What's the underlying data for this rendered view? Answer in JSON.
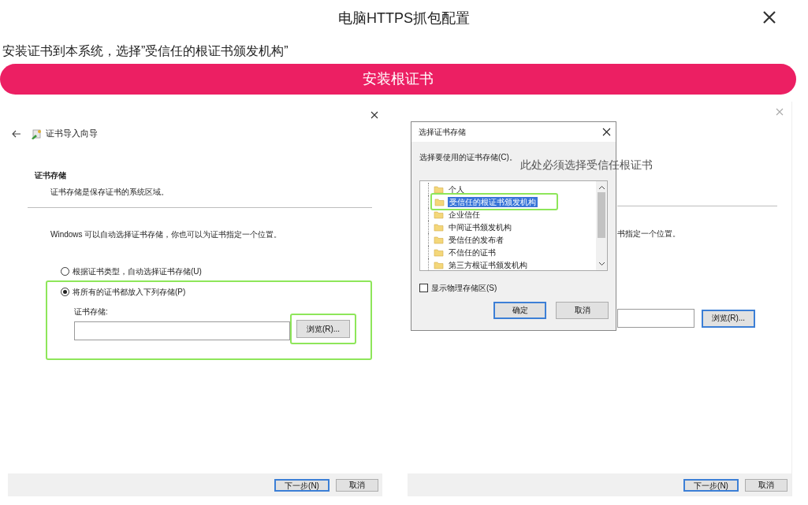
{
  "header": {
    "title": "电脑HTTPS抓包配置"
  },
  "instruction": "安装证书到本系统，选择”受信任的根证书颁发机构”",
  "install_button": "安装根证书",
  "left_wizard": {
    "title": "证书导入向导",
    "section_title": "证书存储",
    "section_desc": "证书存储是保存证书的系统区域。",
    "intro": "Windows 可以自动选择证书存储，你也可以为证书指定一个位置。",
    "options": [
      {
        "label": "根据证书类型，自动选择证书存储(U)",
        "selected": false
      },
      {
        "label": "将所有的证书都放入下列存储(P)",
        "selected": true
      }
    ],
    "store_label": "证书存储:",
    "browse_button": {
      "label": "浏览(R)...",
      "focused": false
    },
    "footer_buttons": [
      {
        "label": "下一步(N)",
        "default": true
      },
      {
        "label": "取消",
        "default": false
      }
    ]
  },
  "right_wizard": {
    "intro": "书指定一个位置。",
    "browse_button": {
      "label": "浏览(R)...",
      "focused": true
    },
    "footer_buttons": [
      {
        "label": "下一步(N)",
        "default": true
      },
      {
        "label": "取消",
        "default": false
      }
    ]
  },
  "store_dialog": {
    "title": "选择证书存储",
    "prompt": "选择要使用的证书存储(C)。",
    "stores": [
      {
        "label": "个人",
        "selected": false
      },
      {
        "label": "受信任的根证书颁发机构",
        "selected": true
      },
      {
        "label": "企业信任",
        "selected": false
      },
      {
        "label": "中间证书颁发机构",
        "selected": false
      },
      {
        "label": "受信任的发布者",
        "selected": false
      },
      {
        "label": "不信任的证书",
        "selected": false
      },
      {
        "label": "第三方根证书颁发机构",
        "selected": false
      }
    ],
    "show_physical": {
      "label": "显示物理存储区(S)",
      "checked": false
    },
    "buttons": [
      {
        "label": "确定",
        "default": true
      },
      {
        "label": "取消",
        "default": false
      }
    ]
  },
  "annotation": "此处必须选择受信任根证书"
}
